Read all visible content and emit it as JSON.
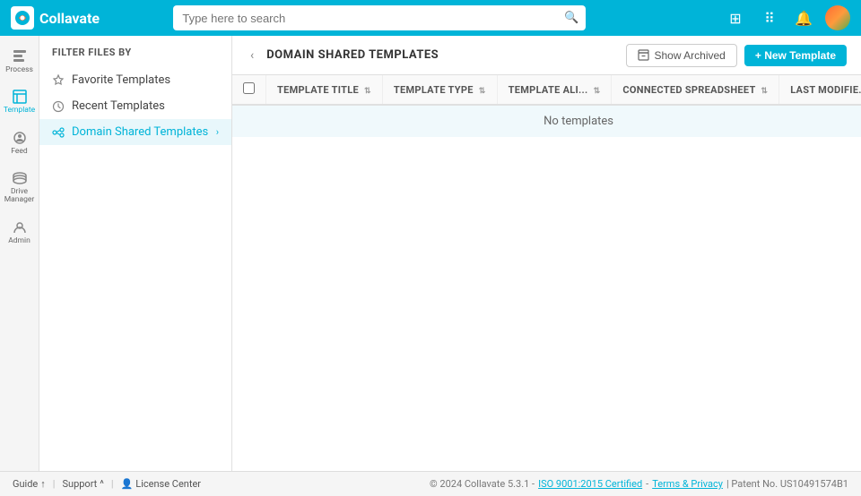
{
  "topbar": {
    "logo_text": "Collavate",
    "search_placeholder": "Type here to search"
  },
  "sidebar": {
    "filter_label": "FILTER FILES BY",
    "items": [
      {
        "id": "favorite-templates",
        "label": "Favorite Templates",
        "icon": "star"
      },
      {
        "id": "recent-templates",
        "label": "Recent Templates",
        "icon": "clock"
      },
      {
        "id": "domain-shared-templates",
        "label": "Domain Shared Templates",
        "icon": "share",
        "active": true,
        "has_chevron": true
      }
    ]
  },
  "left_nav": {
    "items": [
      {
        "id": "process",
        "label": "Process",
        "icon": "process"
      },
      {
        "id": "template",
        "label": "Template",
        "icon": "template",
        "active": true
      },
      {
        "id": "feed",
        "label": "Feed",
        "icon": "feed"
      },
      {
        "id": "drive-manager",
        "label": "Drive Manager",
        "icon": "drive"
      },
      {
        "id": "admin",
        "label": "Admin",
        "icon": "admin"
      }
    ]
  },
  "content": {
    "back_button": "‹",
    "title": "DOMAIN SHARED TEMPLATES",
    "show_archived_label": "Show Archived",
    "new_template_label": "+ New Template",
    "table": {
      "columns": [
        {
          "id": "checkbox",
          "label": ""
        },
        {
          "id": "template-title",
          "label": "TEMPLATE TITLE"
        },
        {
          "id": "template-type",
          "label": "TEMPLATE TYPE"
        },
        {
          "id": "template-alias",
          "label": "TEMPLATE ALI..."
        },
        {
          "id": "connected-spreadsheet",
          "label": "CONNECTED SPREADSHEET"
        },
        {
          "id": "last-modified",
          "label": "LAST MODIFIE..."
        }
      ],
      "no_data_message": "No templates"
    }
  },
  "footer": {
    "guide_label": "Guide",
    "guide_icon": "↑",
    "support_label": "Support",
    "support_icon": "^",
    "license_label": "License Center",
    "copyright": "© 2024 Collavate 5.3.1 -",
    "iso_link": "ISO 9001:2015 Certified",
    "separator": "-",
    "terms_link": "Terms & Privacy",
    "patent": "| Patent No. US10491574B1"
  }
}
